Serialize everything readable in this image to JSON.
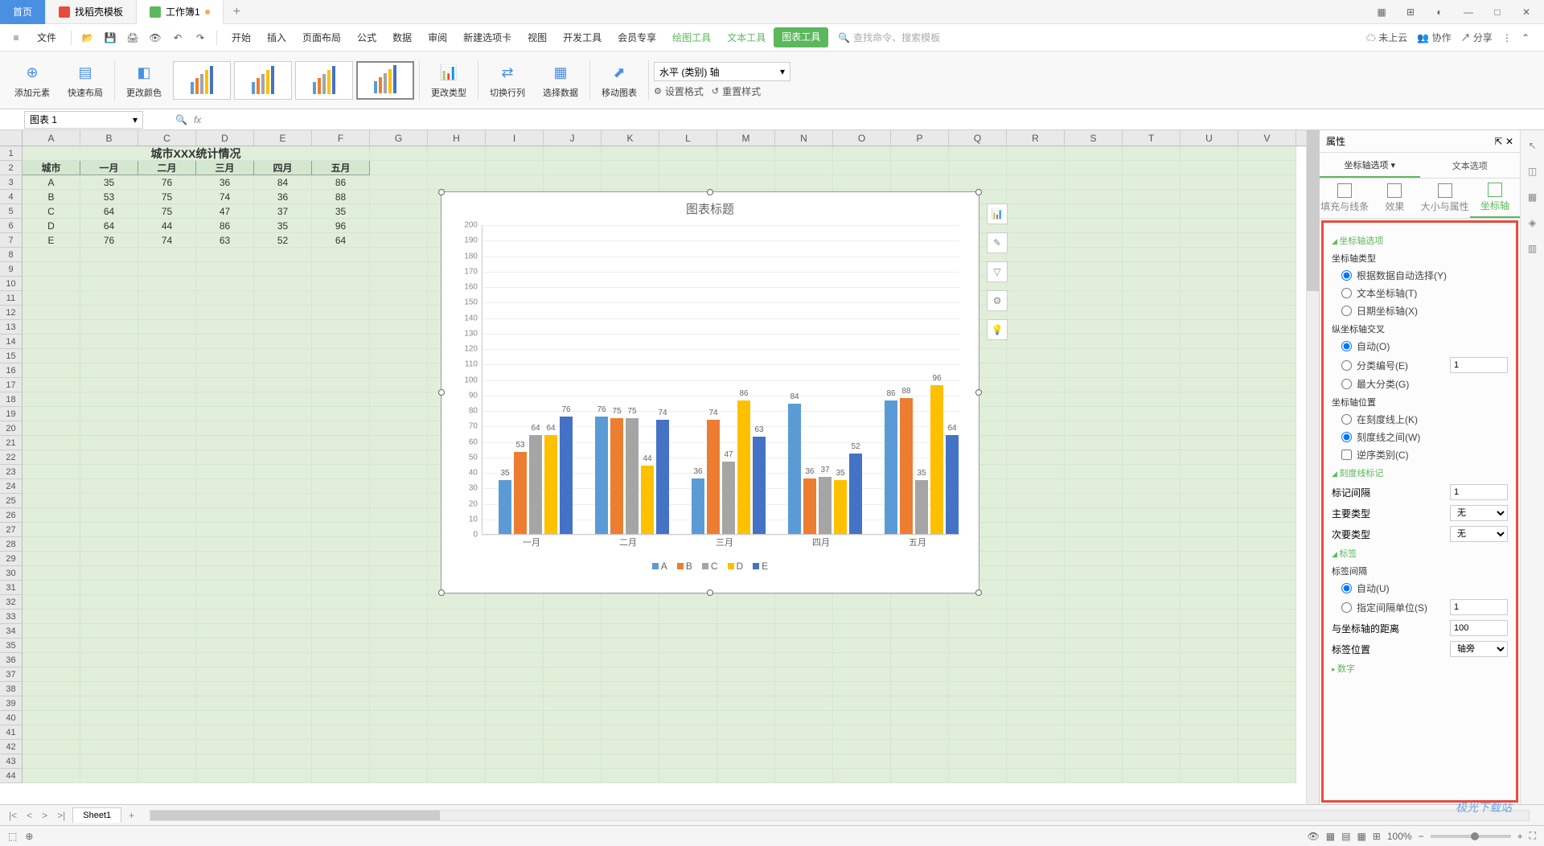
{
  "titlebar": {
    "home": "首页",
    "tab1": "找稻壳模板",
    "tab2": "工作簿1",
    "plus": "+"
  },
  "menubar": {
    "file": "文件",
    "items": [
      "开始",
      "插入",
      "页面布局",
      "公式",
      "数据",
      "审阅",
      "新建选项卡",
      "视图",
      "开发工具",
      "会员专享"
    ],
    "green_items": [
      "绘图工具",
      "文本工具"
    ],
    "highlighted": "图表工具",
    "search_placeholder": "查找命令、搜索模板",
    "right": {
      "cloud": "未上云",
      "coop": "协作",
      "share": "分享"
    }
  },
  "ribbon": {
    "add_element": "添加元素",
    "quick_layout": "快速布局",
    "change_color": "更改颜色",
    "change_type": "更改类型",
    "switch_rowcol": "切换行列",
    "select_data": "选择数据",
    "move_chart": "移动图表",
    "axis_select": "水平 (类别) 轴",
    "set_format": "设置格式",
    "reset_style": "重置样式"
  },
  "namebox": "图表 1",
  "table": {
    "title": "城市XXX统计情况",
    "headers": [
      "城市",
      "一月",
      "二月",
      "三月",
      "四月",
      "五月"
    ],
    "rows": [
      [
        "A",
        "35",
        "76",
        "36",
        "84",
        "86"
      ],
      [
        "B",
        "53",
        "75",
        "74",
        "36",
        "88"
      ],
      [
        "C",
        "64",
        "75",
        "47",
        "37",
        "35"
      ],
      [
        "D",
        "64",
        "44",
        "86",
        "35",
        "96"
      ],
      [
        "E",
        "76",
        "74",
        "63",
        "52",
        "64"
      ]
    ]
  },
  "columns": [
    "A",
    "B",
    "C",
    "D",
    "E",
    "F",
    "G",
    "H",
    "I",
    "J",
    "K",
    "L",
    "M",
    "N",
    "O",
    "P",
    "Q",
    "R",
    "S",
    "T",
    "U",
    "V"
  ],
  "chart": {
    "title": "图表标题"
  },
  "chart_data": {
    "type": "bar",
    "categories": [
      "一月",
      "二月",
      "三月",
      "四月",
      "五月"
    ],
    "series": [
      {
        "name": "A",
        "color": "#5b9bd5",
        "values": [
          35,
          76,
          36,
          84,
          86
        ]
      },
      {
        "name": "B",
        "color": "#ed7d31",
        "values": [
          53,
          75,
          74,
          36,
          88
        ]
      },
      {
        "name": "C",
        "color": "#a5a5a5",
        "values": [
          64,
          75,
          47,
          37,
          35
        ]
      },
      {
        "name": "D",
        "color": "#ffc000",
        "values": [
          64,
          44,
          86,
          35,
          96
        ]
      },
      {
        "name": "E",
        "color": "#4472c4",
        "values": [
          76,
          74,
          63,
          52,
          64
        ]
      }
    ],
    "title": "图表标题",
    "xlabel": "",
    "ylabel": "",
    "ylim": [
      0,
      200
    ],
    "ystep": 10
  },
  "panel": {
    "title": "属性",
    "tab1": "坐标轴选项 ▾",
    "tab2": "文本选项",
    "sub": [
      "填充与线条",
      "效果",
      "大小与属性",
      "坐标轴"
    ],
    "sec_axis": "坐标轴选项",
    "axis_type": "坐标轴类型",
    "axis_type_opts": [
      "根据数据自动选择(Y)",
      "文本坐标轴(T)",
      "日期坐标轴(X)"
    ],
    "cross": "纵坐标轴交叉",
    "cross_opts": [
      "自动(O)",
      "分类编号(E)",
      "最大分类(G)"
    ],
    "cross_val": "1",
    "position": "坐标轴位置",
    "position_opts": [
      "在刻度线上(K)",
      "刻度线之间(W)"
    ],
    "reverse": "逆序类别(C)",
    "sec_tick": "刻度线标记",
    "tick_interval": "标记间隔",
    "tick_interval_val": "1",
    "major_type": "主要类型",
    "minor_type": "次要类型",
    "type_none": "无",
    "sec_label": "标签",
    "label_interval": "标签间隔",
    "label_auto": "自动(U)",
    "label_spec": "指定间隔单位(S)",
    "label_spec_val": "1",
    "axis_distance": "与坐标轴的距离",
    "axis_distance_val": "100",
    "label_pos": "标签位置",
    "label_pos_val": "轴旁",
    "sec_number": "数字"
  },
  "sheet": {
    "name": "Sheet1",
    "plus": "+"
  },
  "status": {
    "zoom": "100%"
  },
  "watermark": "极光下载站"
}
